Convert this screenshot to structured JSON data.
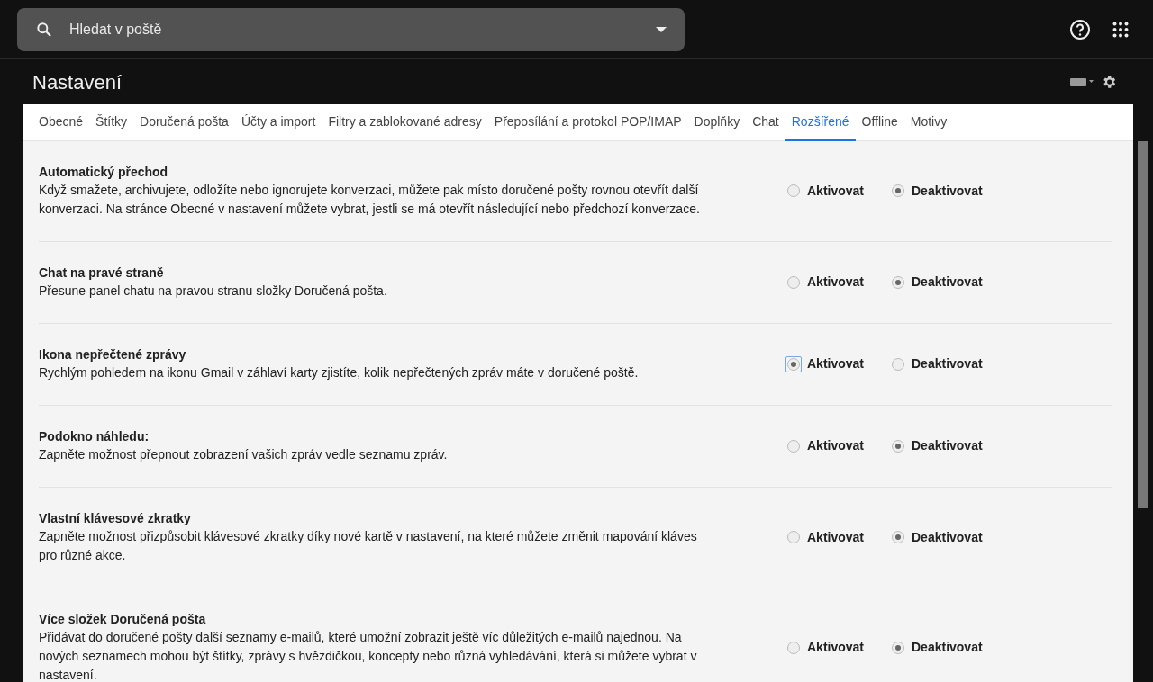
{
  "search": {
    "placeholder": "Hledat v poště"
  },
  "header": {
    "title": "Nastavení"
  },
  "tabs": [
    {
      "label": "Obecné",
      "selected": false
    },
    {
      "label": "Štítky",
      "selected": false
    },
    {
      "label": "Doručená pošta",
      "selected": false
    },
    {
      "label": "Účty a import",
      "selected": false
    },
    {
      "label": "Filtry a zablokované adresy",
      "selected": false
    },
    {
      "label": "Přeposílání a protokol POP/IMAP",
      "selected": false
    },
    {
      "label": "Doplňky",
      "selected": false
    },
    {
      "label": "Chat",
      "selected": false
    },
    {
      "label": "Rozšířené",
      "selected": true
    },
    {
      "label": "Offline",
      "selected": false
    },
    {
      "label": "Motivy",
      "selected": false
    }
  ],
  "settings": [
    {
      "title": "Automatický přechod",
      "description": "Když smažete, archivujete, odložíte nebo ignorujete konverzaci, můžete pak místo doručené pošty rovnou otevřít další konverzaci. Na stránce Obecné v nastavení můžete vybrat, jestli se má otevřít následující nebo předchozí konverzace.",
      "options": [
        {
          "label": "Aktivovat",
          "selected": false,
          "focused": false
        },
        {
          "label": "Deaktivovat",
          "selected": true,
          "focused": false
        }
      ]
    },
    {
      "title": "Chat na pravé straně",
      "description": "Přesune panel chatu na pravou stranu složky Doručená pošta.",
      "options": [
        {
          "label": "Aktivovat",
          "selected": false,
          "focused": false
        },
        {
          "label": "Deaktivovat",
          "selected": true,
          "focused": false
        }
      ]
    },
    {
      "title": "Ikona nepřečtené zprávy",
      "description": "Rychlým pohledem na ikonu Gmail v záhlaví karty zjistíte, kolik nepřečtených zpráv máte v doručené poště.",
      "options": [
        {
          "label": "Aktivovat",
          "selected": true,
          "focused": true
        },
        {
          "label": "Deaktivovat",
          "selected": false,
          "focused": false
        }
      ]
    },
    {
      "title": "Podokno náhledu:",
      "description": "Zapněte možnost přepnout zobrazení vašich zpráv vedle seznamu zpráv.",
      "options": [
        {
          "label": "Aktivovat",
          "selected": false,
          "focused": false
        },
        {
          "label": "Deaktivovat",
          "selected": true,
          "focused": false
        }
      ]
    },
    {
      "title": "Vlastní klávesové zkratky",
      "description": "Zapněte možnost přizpůsobit klávesové zkratky díky nové kartě v nastavení, na které můžete změnit mapování kláves pro různé akce.",
      "options": [
        {
          "label": "Aktivovat",
          "selected": false,
          "focused": false
        },
        {
          "label": "Deaktivovat",
          "selected": true,
          "focused": false
        }
      ]
    },
    {
      "title": "Více složek Doručená pošta",
      "description": "Přidávat do doručené pošty další seznamy e-mailů, které umožní zobrazit ještě víc důležitých e-mailů najednou. Na nových seznamech mohou být štítky, zprávy s hvězdičkou, koncepty nebo různá vyhledávání, která si můžete vybrat v nastavení.",
      "options": [
        {
          "label": "Aktivovat",
          "selected": false,
          "focused": false
        },
        {
          "label": "Deaktivovat",
          "selected": true,
          "focused": false
        }
      ]
    }
  ]
}
